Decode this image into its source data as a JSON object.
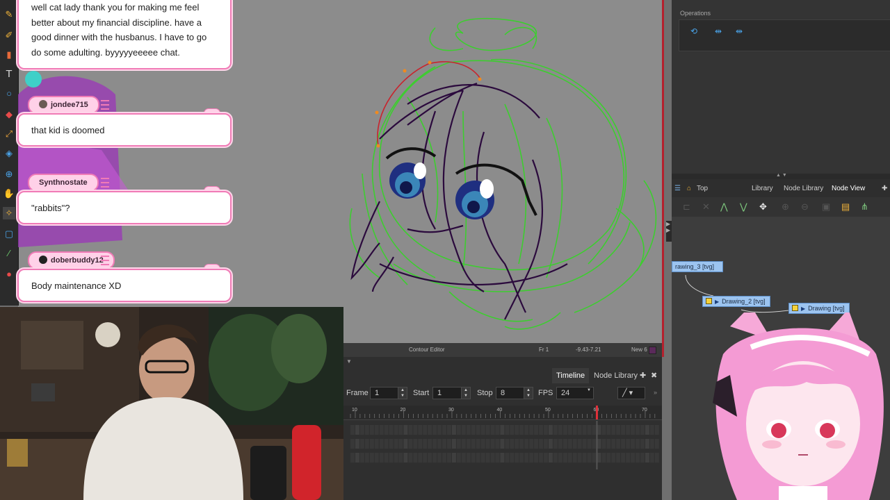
{
  "chat": {
    "messages": [
      {
        "text": "well cat lady thank you for making me feel better about my financial discipline. have a good dinner with the husbanus. I have to go do some adulting. byyyyyeeeee chat."
      },
      {
        "user": "jondee715",
        "text": "that kid is doomed"
      },
      {
        "user": "Synthnostate",
        "text": "\"rabbits\"?"
      },
      {
        "user": "doberbuddy12",
        "text": "Body maintenance XD"
      }
    ]
  },
  "status_bar": {
    "mode": "Contour Editor",
    "frame": "Fr 1",
    "coords": "-9.43-7.21",
    "layer": "New 6"
  },
  "timeline": {
    "tabs": [
      "Timeline",
      "Node Library"
    ],
    "frame_label": "Frame",
    "frame_value": "1",
    "start_label": "Start",
    "start_value": "1",
    "stop_label": "Stop",
    "stop_value": "8",
    "fps_label": "FPS",
    "fps_value": "24",
    "ruler_ticks": [
      "10",
      "20",
      "30",
      "40",
      "50",
      "60",
      "70"
    ],
    "playhead_frame": 60
  },
  "operations": {
    "title": "Operations"
  },
  "node_view": {
    "breadcrumb": "Top",
    "tabs": [
      "Library",
      "Node Library",
      "Node View"
    ],
    "nodes": [
      "rawing_3 [tvg]",
      "Drawing_2 [tvg]",
      "Drawing [tvg]"
    ]
  },
  "icons": {
    "toolstrip": [
      "pencil-icon",
      "brush-icon",
      "text-icon",
      "ellipse-icon",
      "stamp-icon",
      "eraser-icon",
      "transform-icon",
      "hand-icon",
      "select-icon",
      "contour-editor-icon",
      "zoom-icon",
      "eyedropper-icon",
      "paint-icon"
    ],
    "operations": [
      "rotate-icon",
      "flip-horizontal-icon",
      "flip-vertical-icon"
    ]
  },
  "colors": {
    "accent_pink": "#f07bb6",
    "sketch_green": "#39d12b",
    "line_purple": "#2b0a3d",
    "active_border": "#b5202d",
    "node_blue": "#9cc4f0"
  }
}
